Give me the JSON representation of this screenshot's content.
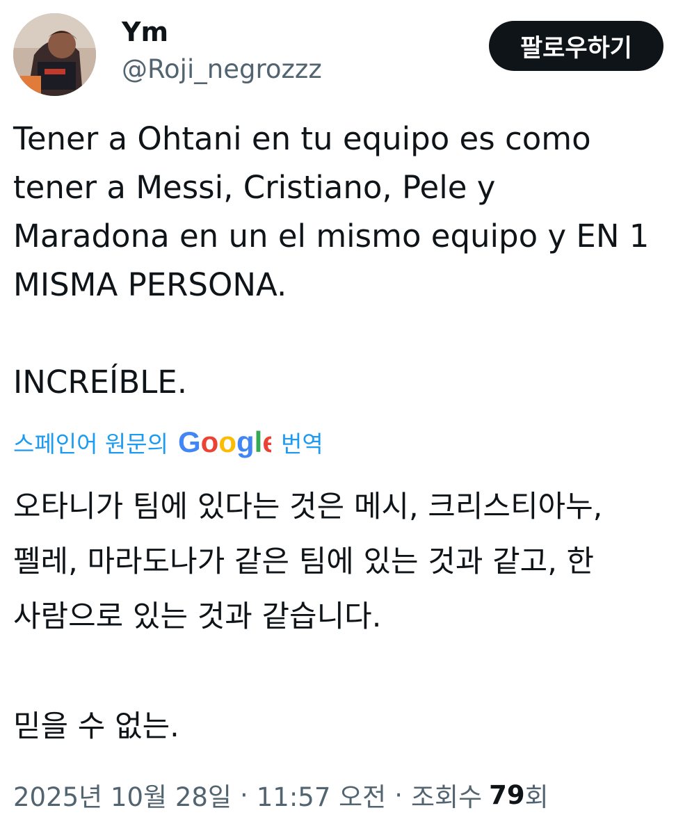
{
  "author": {
    "display_name": "Ym",
    "handle": "@Roji_negrozzz"
  },
  "follow_button": {
    "label": "팔로우하기"
  },
  "tweet": {
    "text": "Tener a Ohtani en tu equipo es como\ntener a Messi, Cristiano, Pele y\nMaradona en un el mismo equipo y EN 1\nMISMA PERSONA.\n\nINCREÍBLE."
  },
  "translation": {
    "prefix": "스페인어 원문의",
    "provider": "Google",
    "suffix": "번역",
    "text": "오타니가 팀에 있다는 것은 메시, 크리스티아누,\n펠레, 마라도나가 같은 팀에 있는 것과 같고, 한\n사람으로 있는 것과 같습니다.\n\n믿을 수 없는."
  },
  "meta": {
    "date": "2025년 10월 28일",
    "separator": "·",
    "time": "11:57 오전",
    "views_label": "조회수",
    "views_count": "79",
    "views_suffix": "회"
  },
  "colors": {
    "link_blue": "#1d9bf0",
    "text_primary": "#0f1419",
    "text_secondary": "#536471",
    "button_bg": "#0f1419",
    "google_blue": "#4285F4",
    "google_red": "#EA4335",
    "google_yellow": "#FBBC05",
    "google_green": "#34A853"
  }
}
